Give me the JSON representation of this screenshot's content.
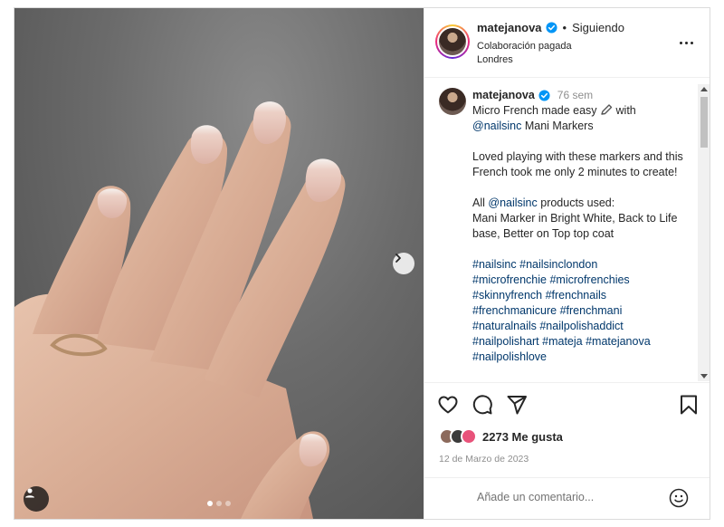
{
  "header": {
    "username": "matejanova",
    "separator": "•",
    "follow_state": "Siguiendo",
    "paid_partnership": "Colaboración pagada",
    "location": "Londres"
  },
  "caption": {
    "username": "matejanova",
    "time_ago": "76 sem",
    "line1_a": "Micro French made easy",
    "line1_b": "with",
    "mention1": "@nailsinc",
    "line2_rest": " Mani Markers",
    "para2": "Loved playing with these markers and this French took me only 2 minutes to create!",
    "para3_a": "All ",
    "mention2": "@nailsinc",
    "para3_b": " products used:",
    "para3_c": "Mani Marker in Bright White, Back to Life base, Better on Top top coat",
    "hashtags": [
      "#nailsinc #nailsinclondon",
      "#microfrenchie #microfrenchies",
      "#skinnyfrench #frenchnails",
      "#frenchmanicure #frenchmani",
      "#naturalnails #nailpolishaddict",
      "#nailpolishart #mateja #matejanova",
      "#nailpolishlove"
    ]
  },
  "engagement": {
    "likes_text": "2273 Me gusta",
    "date": "12 de Marzo de 2023"
  },
  "comment": {
    "placeholder": "Añade un comentario..."
  },
  "carousel": {
    "slide_count": 3,
    "active_index": 0
  },
  "colors": {
    "link": "#00376b",
    "verified": "#0095f6",
    "muted": "#8e8e8e"
  },
  "icons": [
    "user-tag-icon",
    "chevron-right-icon",
    "verified-icon",
    "more-icon",
    "heart-icon",
    "comment-icon",
    "share-icon",
    "save-icon",
    "emoji-icon",
    "pencil-emoji"
  ]
}
